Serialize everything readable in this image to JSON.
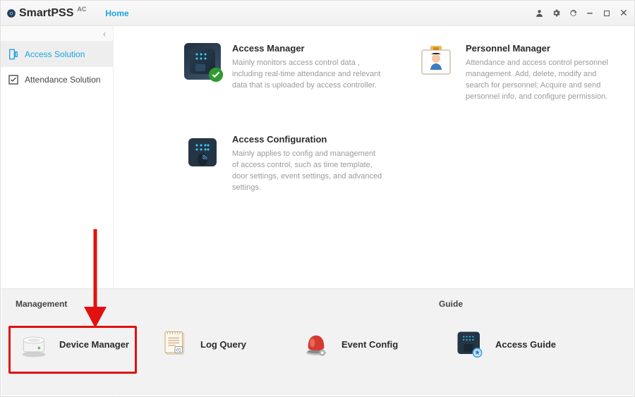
{
  "app": {
    "name": "SmartPSS",
    "name_sup": "AC",
    "home_tab": "Home"
  },
  "title_icons": {
    "user": "user-icon",
    "settings": "gear-icon",
    "refresh": "sync-icon",
    "minimize": "minimize-icon",
    "maximize": "maximize-icon",
    "close": "close-icon"
  },
  "sidebar": {
    "items": [
      {
        "label": "Access Solution",
        "active": true
      },
      {
        "label": "Attendance Solution",
        "active": false
      }
    ]
  },
  "cards": {
    "access_manager": {
      "title": "Access Manager",
      "desc": "Mainly monitors access control data , including real-time attendance and relevant data that is uploaded by access controller."
    },
    "personnel_manager": {
      "title": "Personnel Manager",
      "desc": "Attendance and access control personnel management.  Add, delete, modify and search for personnel; Acquire and send personnel info, and configure permission."
    },
    "access_config": {
      "title": "Access Configuration",
      "desc": "Mainly applies to config and management of access control, such as time template, door settings, event settings, and advanced settings."
    }
  },
  "mgmt": {
    "header_management": "Management",
    "header_guide": "Guide",
    "items": {
      "device_manager": "Device Manager",
      "log_query": "Log Query",
      "event_config": "Event Config",
      "access_guide": "Access Guide"
    }
  },
  "annotation": {
    "highlight_target": "device-manager-button"
  }
}
